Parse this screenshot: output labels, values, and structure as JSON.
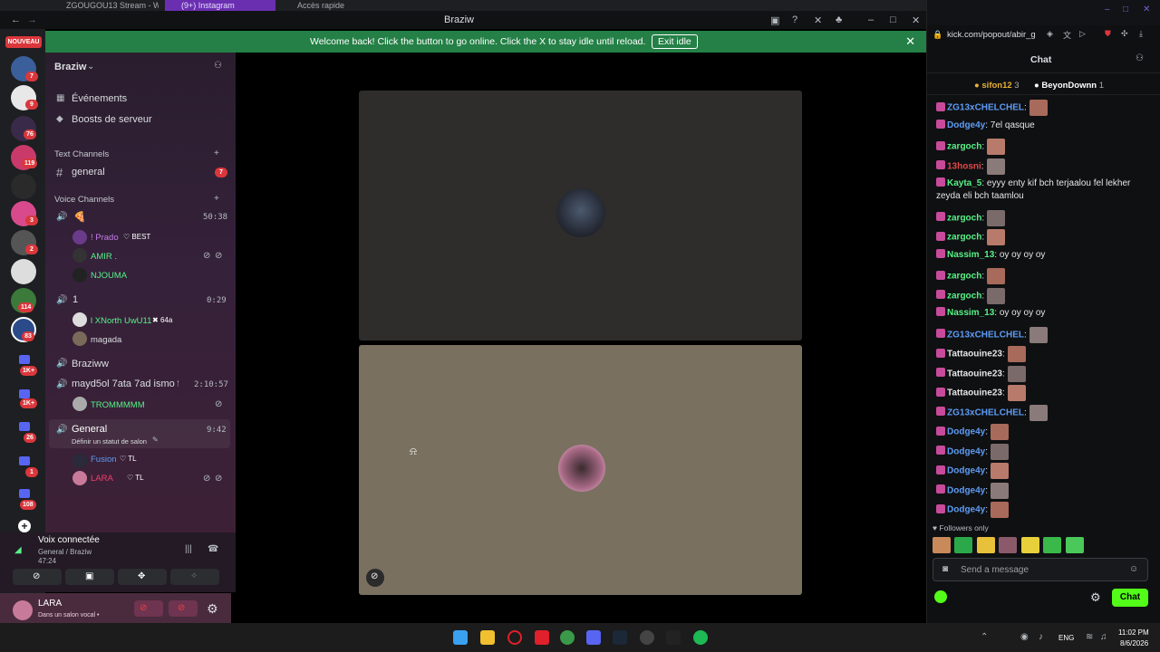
{
  "browser_tabs": [
    {
      "label": "ZGOUGOU13 Stream - Wat",
      "active": false
    },
    {
      "label": "(9+) Instagram",
      "active": true
    },
    {
      "label": "Accès rapide",
      "active": false
    }
  ],
  "window": {
    "title": "Braziw"
  },
  "banner": {
    "text": "Welcome back! Click the button to go online. Click the X to stay idle until reload.",
    "button": "Exit idle"
  },
  "rail": {
    "nouveau": "NOUVEAU",
    "badges": [
      "7",
      "9",
      "76",
      "119",
      "3",
      "2",
      "114",
      "83",
      "1K+",
      "1K+",
      "26",
      "1",
      "108"
    ]
  },
  "sidebar": {
    "server_name": "Braziw",
    "top_items": [
      {
        "label": "Événements"
      },
      {
        "label": "Boosts de serveur"
      }
    ],
    "text_category": "Text Channels",
    "text_channels": [
      {
        "label": "general",
        "badge": "7"
      }
    ],
    "voice_category": "Voice Channels",
    "voice_channels": [
      {
        "label": "🍕",
        "time": "50:38",
        "users": [
          {
            "name": "! Prado",
            "tag": "BEST",
            "color": "#c47ce8"
          },
          {
            "name": "AMIR .",
            "tag": "",
            "color": "#57f287"
          },
          {
            "name": "NJOUMA",
            "tag": "",
            "color": "#57f287"
          }
        ]
      },
      {
        "label": "1",
        "time": "0:29",
        "users": [
          {
            "name": "l XNorth UwU11",
            "tag": "64a",
            "color": "#57f287"
          },
          {
            "name": "magada",
            "tag": "",
            "color": "#dbdee1"
          }
        ]
      },
      {
        "label": "Braziww",
        "time": "",
        "users": []
      },
      {
        "label": "mayd5ol 7ata 7ad ismo f...",
        "time": "2:10:57",
        "users": [
          {
            "name": "TROMMMMM",
            "tag": "",
            "color": "#57f287"
          }
        ]
      },
      {
        "label": "General",
        "time": "9:42",
        "status": "Définir un statut de salon",
        "users": [
          {
            "name": "Fusion",
            "tag": "TL",
            "color": "#5e9cf5"
          },
          {
            "name": "LARA",
            "tag": "TL",
            "color": "#f23f6c"
          }
        ]
      }
    ]
  },
  "voice_panel": {
    "title": "Voix connectée",
    "subtitle": "General / Braziw",
    "timer": "47:24"
  },
  "user_panel": {
    "name": "LARA",
    "status": "Dans un salon vocal • "
  },
  "chat": {
    "url": "kick.com/popout/abir_g",
    "header": "Chat",
    "gifters": [
      {
        "name": "sifon12",
        "count": "3"
      },
      {
        "name": "BeyonDownn",
        "count": "1"
      }
    ],
    "messages": [
      {
        "user": "ZG13xCHELCHEL",
        "color": "#5e9cf5",
        "text": ":"
      },
      {
        "user": "Dodge4y",
        "color": "#5e9cf5",
        "text": ": 7el qasque"
      },
      {
        "user": "zargoch",
        "color": "#57f287",
        "text": ":"
      },
      {
        "user": "13hosni",
        "color": "#e04848",
        "text": ":"
      },
      {
        "user": "Kayta_5",
        "color": "#57f287",
        "text": ": eyyy enty kif bch terjaalou fel lekher",
        "text2": "zeyda eli bch taamlou"
      },
      {
        "user": "zargoch",
        "color": "#57f287",
        "text": ":"
      },
      {
        "user": "zargoch",
        "color": "#57f287",
        "text": ":"
      },
      {
        "user": "Nassim_13",
        "color": "#57f287",
        "text": ": oy oy oy oy"
      },
      {
        "user": "zargoch",
        "color": "#57f287",
        "text": ":"
      },
      {
        "user": "zargoch",
        "color": "#57f287",
        "text": ":"
      },
      {
        "user": "Nassim_13",
        "color": "#57f287",
        "text": ": oy oy oy oy"
      },
      {
        "user": "ZG13xCHELCHEL",
        "color": "#5e9cf5",
        "text": ":"
      },
      {
        "user": "Tattaouine23",
        "color": "#e6e6e6",
        "text": ":"
      },
      {
        "user": "Tattaouine23",
        "color": "#e6e6e6",
        "text": ":"
      },
      {
        "user": "Tattaouine23",
        "color": "#e6e6e6",
        "text": ":"
      },
      {
        "user": "ZG13xCHELCHEL",
        "color": "#5e9cf5",
        "text": ":"
      },
      {
        "user": "Dodge4y",
        "color": "#5e9cf5",
        "text": ":"
      },
      {
        "user": "Dodge4y",
        "color": "#5e9cf5",
        "text": ":"
      },
      {
        "user": "Dodge4y",
        "color": "#5e9cf5",
        "text": ":"
      },
      {
        "user": "Dodge4y",
        "color": "#5e9cf5",
        "text": ":"
      },
      {
        "user": "Dodge4y",
        "color": "#5e9cf5",
        "text": ":"
      }
    ],
    "followers_only": "Followers only",
    "input_placeholder": "Send a message",
    "send_label": "Chat"
  },
  "taskbar": {
    "lang": "ENG",
    "time": "11:02 PM",
    "date": "8/6/2026"
  },
  "colors": {
    "kick_green": "#53fc18",
    "discord_green": "#248046",
    "accent": "#5865f2"
  }
}
